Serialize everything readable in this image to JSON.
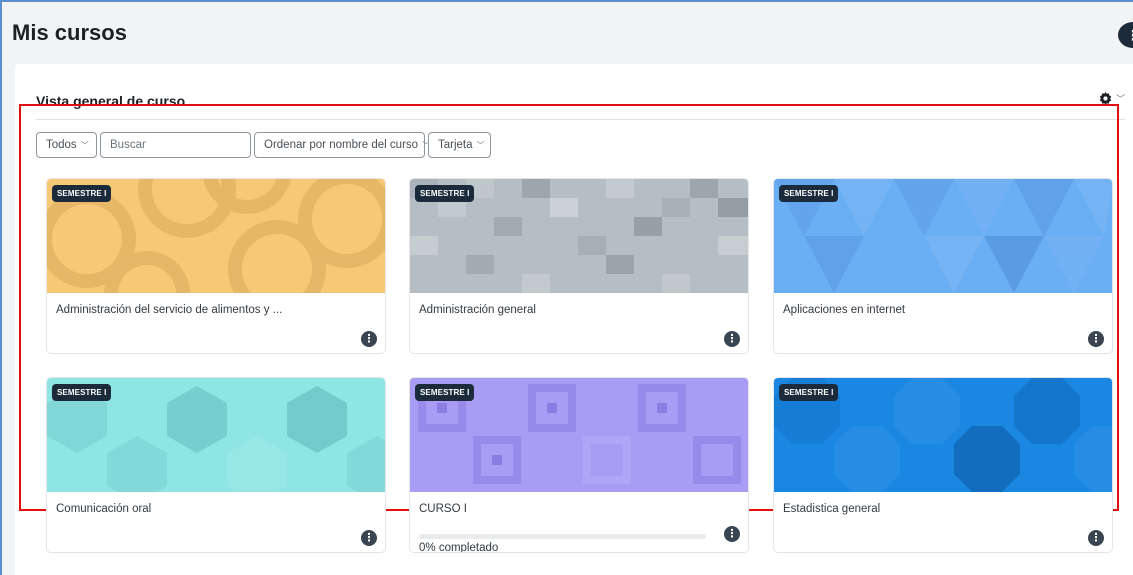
{
  "page": {
    "title": "Mis cursos"
  },
  "header": {
    "user_menu_glyph": "⋮"
  },
  "block": {
    "title": "Vista general de curso",
    "settings_icon": "gear-icon"
  },
  "filters": {
    "grouping": "Todos",
    "search_placeholder": "Buscar",
    "sort": "Ordenar por nombre del curso",
    "view": "Tarjeta"
  },
  "courses": [
    {
      "category": "SEMESTRE I",
      "name": "Administración del servicio de alimentos y ...",
      "pattern": "circles",
      "color": "#f7c976"
    },
    {
      "category": "SEMESTRE I",
      "name": "Administración general",
      "pattern": "squares",
      "color": "#b5bec4"
    },
    {
      "category": "SEMESTRE I",
      "name": "Aplicaciones en internet",
      "pattern": "triangles",
      "color": "#6aaef3"
    },
    {
      "category": "SEMESTRE I",
      "name": "Comunicación oral",
      "pattern": "hexagons",
      "color": "#8fe4e4"
    },
    {
      "category": "SEMESTRE I",
      "name": "CURSO I",
      "pattern": "nested-squares",
      "color": "#a89cf4",
      "progress": 0,
      "progress_text": "0% completado"
    },
    {
      "category": "SEMESTRE I",
      "name": "Estadistica general",
      "pattern": "octagons",
      "color": "#1a87e2"
    }
  ],
  "colors": {
    "badge_bg": "#1b2b3c",
    "highlight_border": "#e01010",
    "progress_fill": "#0f6cbf"
  }
}
